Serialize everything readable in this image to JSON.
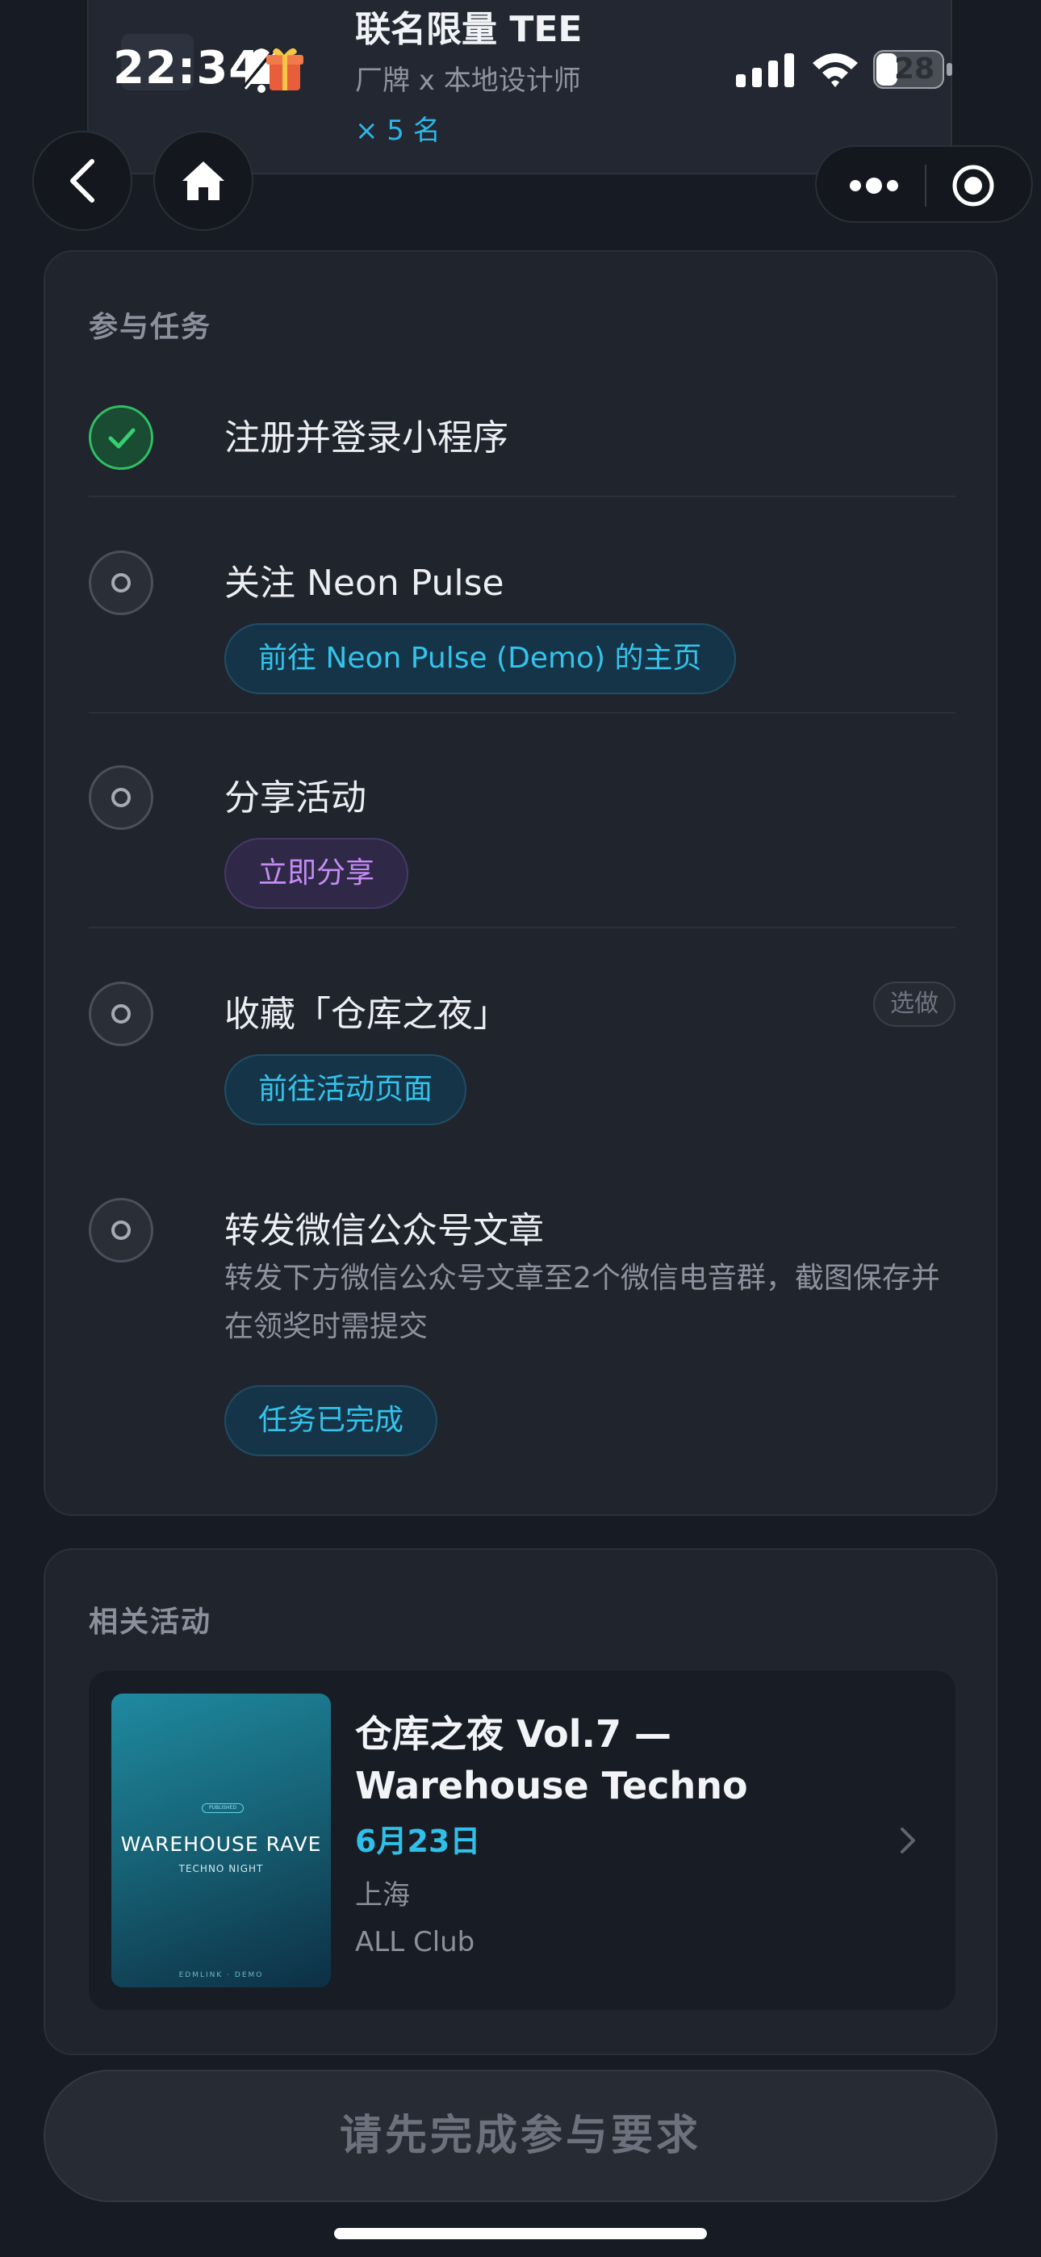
{
  "status_bar": {
    "time": "22:34",
    "battery": "28"
  },
  "prize": {
    "title": "联名限量 TEE",
    "subtitle": "厂牌 x 本地设计师",
    "quantity": "× 5 名"
  },
  "tasks": {
    "section_title": "参与任务",
    "items": [
      {
        "label": "注册并登录小程序",
        "status": "done"
      },
      {
        "label": "关注 Neon Pulse",
        "status": "todo",
        "action": "前往 Neon Pulse (Demo) 的主页"
      },
      {
        "label": "分享活动",
        "status": "todo",
        "action": "立即分享"
      },
      {
        "label": "收藏「仓库之夜」",
        "status": "todo",
        "optional_badge": "选做",
        "action": "前往活动页面"
      },
      {
        "label": "转发微信公众号文章",
        "status": "todo",
        "description": "转发下方微信公众号文章至2个微信电音群，截图保存并在领奖时需提交",
        "action": "任务已完成"
      }
    ]
  },
  "related": {
    "section_title": "相关活动",
    "event": {
      "poster_badge": "PUBLISHED",
      "poster_title": "WAREHOUSE RAVE",
      "poster_subtitle": "TECHNO NIGHT",
      "poster_footer": "EDMLINK · DEMO",
      "title": "仓库之夜 Vol.7 — Warehouse Techno",
      "date": "6月23日",
      "city": "上海",
      "venue": "ALL Club"
    }
  },
  "bottom_button": {
    "label": "请先完成参与要求"
  },
  "colors": {
    "background": "#171b23",
    "card": "#20242d",
    "accent_cyan": "#33c3ec",
    "accent_purple": "#c48cf4",
    "success_green": "#2fbf64"
  }
}
